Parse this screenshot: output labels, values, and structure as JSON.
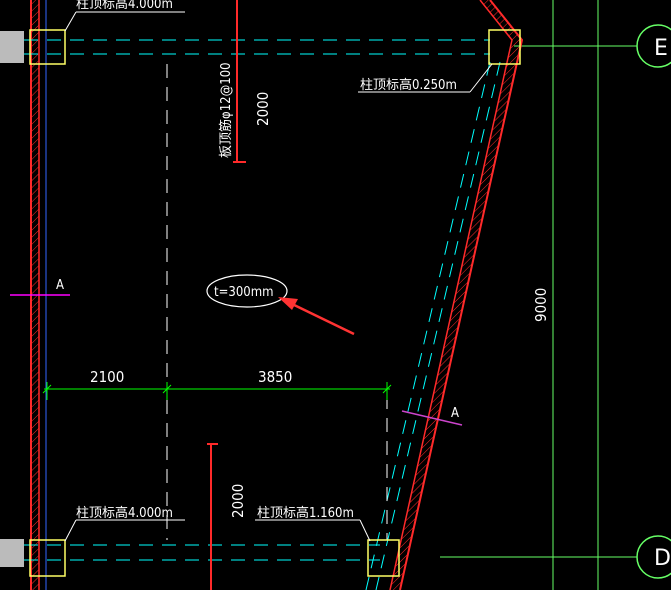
{
  "drawing": {
    "colors": {
      "background": "#000000",
      "wall": "#ff2a2a",
      "column": "#ffff66",
      "dashed_line": "#00ffff",
      "dimension_line": "#00ff00",
      "grid_line": "#66ff66",
      "section_mark_left": "#ff00ff",
      "section_mark_right": "#cc44cc",
      "axis_bubble": "#66ff66",
      "arrow": "#ff3333",
      "end_marker": "#bbbbbb"
    },
    "top_left_column_note": "柱顶标高4.000m",
    "top_right_column_note": "柱顶标高0.250m",
    "rebar_note": "板顶筋φ12@100",
    "dim_2000_top": "2000",
    "thickness_note": "t=300mm",
    "section_left": "A",
    "section_right": "A",
    "dim_2100": "2100",
    "dim_3850": "3850",
    "dim_9000": "9000",
    "dim_2000_bottom": "2000",
    "bottom_left_column_note": "柱顶标高4.000m",
    "bottom_mid_column_note": "柱顶标高1.160m",
    "axis_e": "E",
    "axis_d": "D"
  }
}
